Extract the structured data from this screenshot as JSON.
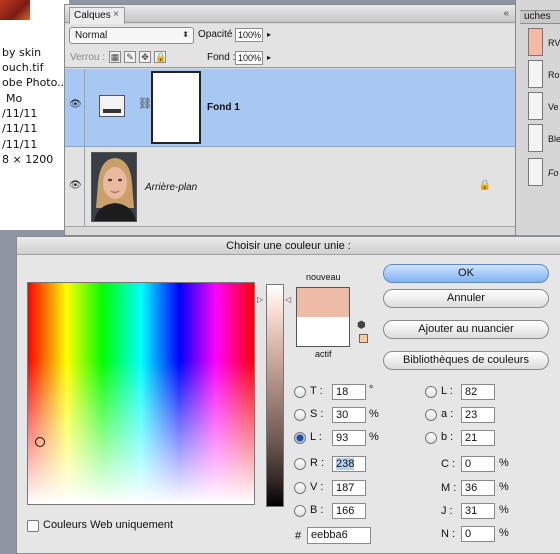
{
  "background_info": {
    "lines": [
      "by skin",
      "ouch.tif",
      "obe Photo...",
      "Mo",
      "/11/11",
      "/11/11",
      "/11/11",
      "8 × 1200"
    ]
  },
  "right_strip": {
    "tab_label": "uches",
    "items": [
      {
        "label": "RV",
        "color": "#f7b8a4"
      },
      {
        "label": "Ro",
        "color": "#f4f4f4"
      },
      {
        "label": "Ve",
        "color": "#f4f4f4"
      },
      {
        "label": "Ble",
        "color": "#f4f4f4"
      },
      {
        "label": "Fo",
        "color": "#f4f4f4"
      }
    ]
  },
  "layers_panel": {
    "tab_label": "Calques",
    "tab_close": "×",
    "collapse": "«",
    "blend_mode": "Normal",
    "blend_arrows": "⬍",
    "opacity_label": "Opacité :",
    "opacity_value": "100%",
    "lock_label": "Verrou :",
    "fill_label": "Fond :",
    "fill_value": "100%",
    "arrow": "▸",
    "lock_icons": [
      "▦",
      "✎",
      "✥",
      "🔒"
    ],
    "layers": [
      {
        "name": "Fond 1",
        "selected": true
      },
      {
        "name": "Arrière-plan",
        "selected": false
      }
    ],
    "eye_icon": "👁",
    "chain_icon": "⛓",
    "lock_icon": "🔒"
  },
  "color_picker": {
    "title": "Choisir une couleur unie :",
    "nouveau_label": "nouveau",
    "actif_label": "actif",
    "new_color": "#eebba6",
    "current_color": "#ffffff",
    "buttons": {
      "ok": "OK",
      "cancel": "Annuler",
      "add_swatch": "Ajouter au nuancier",
      "color_libraries": "Bibliothèques de couleurs"
    },
    "hsb": [
      {
        "key": "T",
        "label": "T :",
        "value": "18",
        "unit": "°",
        "checked": false
      },
      {
        "key": "S",
        "label": "S :",
        "value": "30",
        "unit": "%",
        "checked": false
      },
      {
        "key": "L",
        "label": "L :",
        "value": "93",
        "unit": "%",
        "checked": true
      }
    ],
    "rgb": [
      {
        "key": "R",
        "label": "R :",
        "value": "238",
        "checked": false
      },
      {
        "key": "V",
        "label": "V :",
        "value": "187",
        "checked": false
      },
      {
        "key": "B",
        "label": "B :",
        "value": "166",
        "checked": false
      }
    ],
    "lab": [
      {
        "key": "L",
        "label": "L :",
        "value": "82",
        "checked": false
      },
      {
        "key": "a",
        "label": "a :",
        "value": "23",
        "checked": false
      },
      {
        "key": "b",
        "label": "b :",
        "value": "21",
        "checked": false
      }
    ],
    "cmyk": [
      {
        "key": "C",
        "label": "C :",
        "value": "0",
        "unit": "%"
      },
      {
        "key": "M",
        "label": "M :",
        "value": "36",
        "unit": "%"
      },
      {
        "key": "J",
        "label": "J :",
        "value": "31",
        "unit": "%"
      },
      {
        "key": "N",
        "label": "N :",
        "value": "0",
        "unit": "%"
      }
    ],
    "hex_label": "#",
    "hex_value": "eebba6",
    "web_colors_label": "Couleurs Web uniquement"
  }
}
